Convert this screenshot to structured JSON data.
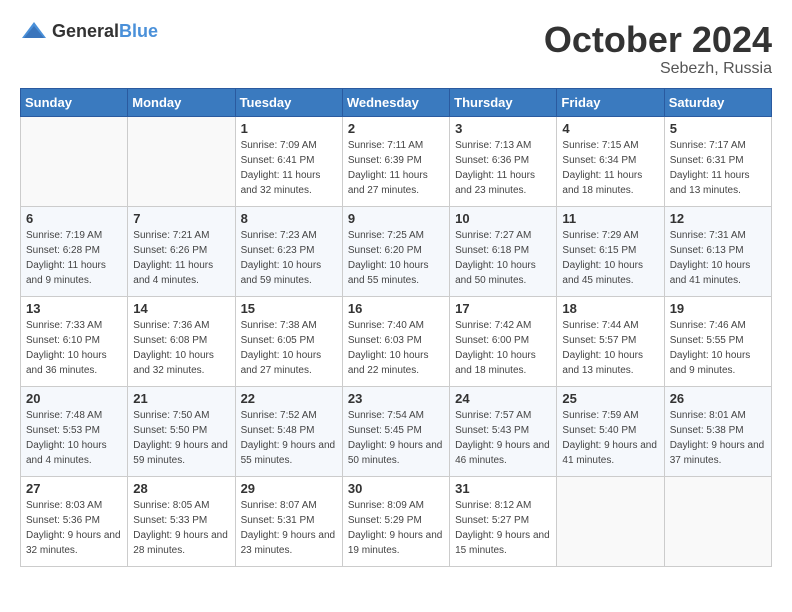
{
  "header": {
    "logo_general": "General",
    "logo_blue": "Blue",
    "month_year": "October 2024",
    "location": "Sebezh, Russia"
  },
  "weekdays": [
    "Sunday",
    "Monday",
    "Tuesday",
    "Wednesday",
    "Thursday",
    "Friday",
    "Saturday"
  ],
  "weeks": [
    [
      {
        "day": "",
        "sunrise": "",
        "sunset": "",
        "daylight": ""
      },
      {
        "day": "",
        "sunrise": "",
        "sunset": "",
        "daylight": ""
      },
      {
        "day": "1",
        "sunrise": "Sunrise: 7:09 AM",
        "sunset": "Sunset: 6:41 PM",
        "daylight": "Daylight: 11 hours and 32 minutes."
      },
      {
        "day": "2",
        "sunrise": "Sunrise: 7:11 AM",
        "sunset": "Sunset: 6:39 PM",
        "daylight": "Daylight: 11 hours and 27 minutes."
      },
      {
        "day": "3",
        "sunrise": "Sunrise: 7:13 AM",
        "sunset": "Sunset: 6:36 PM",
        "daylight": "Daylight: 11 hours and 23 minutes."
      },
      {
        "day": "4",
        "sunrise": "Sunrise: 7:15 AM",
        "sunset": "Sunset: 6:34 PM",
        "daylight": "Daylight: 11 hours and 18 minutes."
      },
      {
        "day": "5",
        "sunrise": "Sunrise: 7:17 AM",
        "sunset": "Sunset: 6:31 PM",
        "daylight": "Daylight: 11 hours and 13 minutes."
      }
    ],
    [
      {
        "day": "6",
        "sunrise": "Sunrise: 7:19 AM",
        "sunset": "Sunset: 6:28 PM",
        "daylight": "Daylight: 11 hours and 9 minutes."
      },
      {
        "day": "7",
        "sunrise": "Sunrise: 7:21 AM",
        "sunset": "Sunset: 6:26 PM",
        "daylight": "Daylight: 11 hours and 4 minutes."
      },
      {
        "day": "8",
        "sunrise": "Sunrise: 7:23 AM",
        "sunset": "Sunset: 6:23 PM",
        "daylight": "Daylight: 10 hours and 59 minutes."
      },
      {
        "day": "9",
        "sunrise": "Sunrise: 7:25 AM",
        "sunset": "Sunset: 6:20 PM",
        "daylight": "Daylight: 10 hours and 55 minutes."
      },
      {
        "day": "10",
        "sunrise": "Sunrise: 7:27 AM",
        "sunset": "Sunset: 6:18 PM",
        "daylight": "Daylight: 10 hours and 50 minutes."
      },
      {
        "day": "11",
        "sunrise": "Sunrise: 7:29 AM",
        "sunset": "Sunset: 6:15 PM",
        "daylight": "Daylight: 10 hours and 45 minutes."
      },
      {
        "day": "12",
        "sunrise": "Sunrise: 7:31 AM",
        "sunset": "Sunset: 6:13 PM",
        "daylight": "Daylight: 10 hours and 41 minutes."
      }
    ],
    [
      {
        "day": "13",
        "sunrise": "Sunrise: 7:33 AM",
        "sunset": "Sunset: 6:10 PM",
        "daylight": "Daylight: 10 hours and 36 minutes."
      },
      {
        "day": "14",
        "sunrise": "Sunrise: 7:36 AM",
        "sunset": "Sunset: 6:08 PM",
        "daylight": "Daylight: 10 hours and 32 minutes."
      },
      {
        "day": "15",
        "sunrise": "Sunrise: 7:38 AM",
        "sunset": "Sunset: 6:05 PM",
        "daylight": "Daylight: 10 hours and 27 minutes."
      },
      {
        "day": "16",
        "sunrise": "Sunrise: 7:40 AM",
        "sunset": "Sunset: 6:03 PM",
        "daylight": "Daylight: 10 hours and 22 minutes."
      },
      {
        "day": "17",
        "sunrise": "Sunrise: 7:42 AM",
        "sunset": "Sunset: 6:00 PM",
        "daylight": "Daylight: 10 hours and 18 minutes."
      },
      {
        "day": "18",
        "sunrise": "Sunrise: 7:44 AM",
        "sunset": "Sunset: 5:57 PM",
        "daylight": "Daylight: 10 hours and 13 minutes."
      },
      {
        "day": "19",
        "sunrise": "Sunrise: 7:46 AM",
        "sunset": "Sunset: 5:55 PM",
        "daylight": "Daylight: 10 hours and 9 minutes."
      }
    ],
    [
      {
        "day": "20",
        "sunrise": "Sunrise: 7:48 AM",
        "sunset": "Sunset: 5:53 PM",
        "daylight": "Daylight: 10 hours and 4 minutes."
      },
      {
        "day": "21",
        "sunrise": "Sunrise: 7:50 AM",
        "sunset": "Sunset: 5:50 PM",
        "daylight": "Daylight: 9 hours and 59 minutes."
      },
      {
        "day": "22",
        "sunrise": "Sunrise: 7:52 AM",
        "sunset": "Sunset: 5:48 PM",
        "daylight": "Daylight: 9 hours and 55 minutes."
      },
      {
        "day": "23",
        "sunrise": "Sunrise: 7:54 AM",
        "sunset": "Sunset: 5:45 PM",
        "daylight": "Daylight: 9 hours and 50 minutes."
      },
      {
        "day": "24",
        "sunrise": "Sunrise: 7:57 AM",
        "sunset": "Sunset: 5:43 PM",
        "daylight": "Daylight: 9 hours and 46 minutes."
      },
      {
        "day": "25",
        "sunrise": "Sunrise: 7:59 AM",
        "sunset": "Sunset: 5:40 PM",
        "daylight": "Daylight: 9 hours and 41 minutes."
      },
      {
        "day": "26",
        "sunrise": "Sunrise: 8:01 AM",
        "sunset": "Sunset: 5:38 PM",
        "daylight": "Daylight: 9 hours and 37 minutes."
      }
    ],
    [
      {
        "day": "27",
        "sunrise": "Sunrise: 8:03 AM",
        "sunset": "Sunset: 5:36 PM",
        "daylight": "Daylight: 9 hours and 32 minutes."
      },
      {
        "day": "28",
        "sunrise": "Sunrise: 8:05 AM",
        "sunset": "Sunset: 5:33 PM",
        "daylight": "Daylight: 9 hours and 28 minutes."
      },
      {
        "day": "29",
        "sunrise": "Sunrise: 8:07 AM",
        "sunset": "Sunset: 5:31 PM",
        "daylight": "Daylight: 9 hours and 23 minutes."
      },
      {
        "day": "30",
        "sunrise": "Sunrise: 8:09 AM",
        "sunset": "Sunset: 5:29 PM",
        "daylight": "Daylight: 9 hours and 19 minutes."
      },
      {
        "day": "31",
        "sunrise": "Sunrise: 8:12 AM",
        "sunset": "Sunset: 5:27 PM",
        "daylight": "Daylight: 9 hours and 15 minutes."
      },
      {
        "day": "",
        "sunrise": "",
        "sunset": "",
        "daylight": ""
      },
      {
        "day": "",
        "sunrise": "",
        "sunset": "",
        "daylight": ""
      }
    ]
  ]
}
